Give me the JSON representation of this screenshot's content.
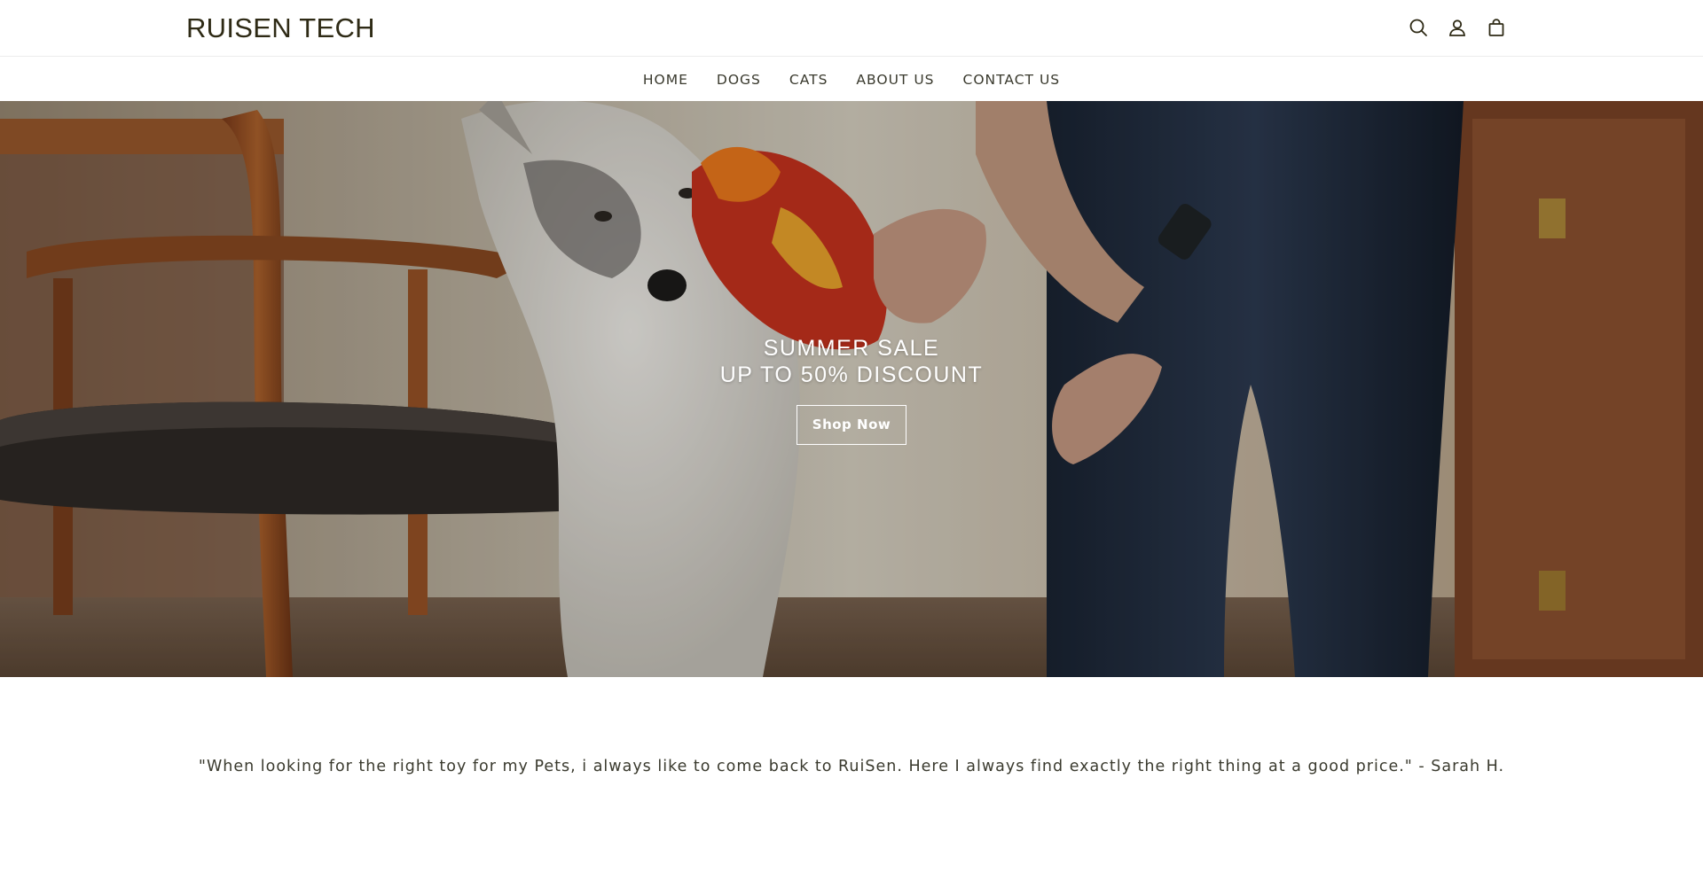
{
  "brand": {
    "logo_text": "RUISEN TECH"
  },
  "header": {
    "icons": [
      {
        "name": "search-icon",
        "label": "Search"
      },
      {
        "name": "account-icon",
        "label": "Log in"
      },
      {
        "name": "cart-icon",
        "label": "Cart"
      }
    ]
  },
  "nav": {
    "items": [
      {
        "label": "HOME"
      },
      {
        "label": "DOGS"
      },
      {
        "label": "CATS"
      },
      {
        "label": "ABOUT US"
      },
      {
        "label": "CONTACT US"
      }
    ]
  },
  "hero": {
    "title": "SUMMER SALE",
    "subtitle": "UP TO 50% DISCOUNT",
    "button_label": "Shop Now"
  },
  "testimonial": {
    "text": "\"When looking for the right toy for my Pets, i always like to come back to RuiSen. Here I always find exactly the right thing at a good price.\" - Sarah H."
  },
  "colors": {
    "text": "#2e2a15",
    "nav_text": "#3a3a2e",
    "background": "#ffffff",
    "hero_button_border": "#ffffff"
  }
}
